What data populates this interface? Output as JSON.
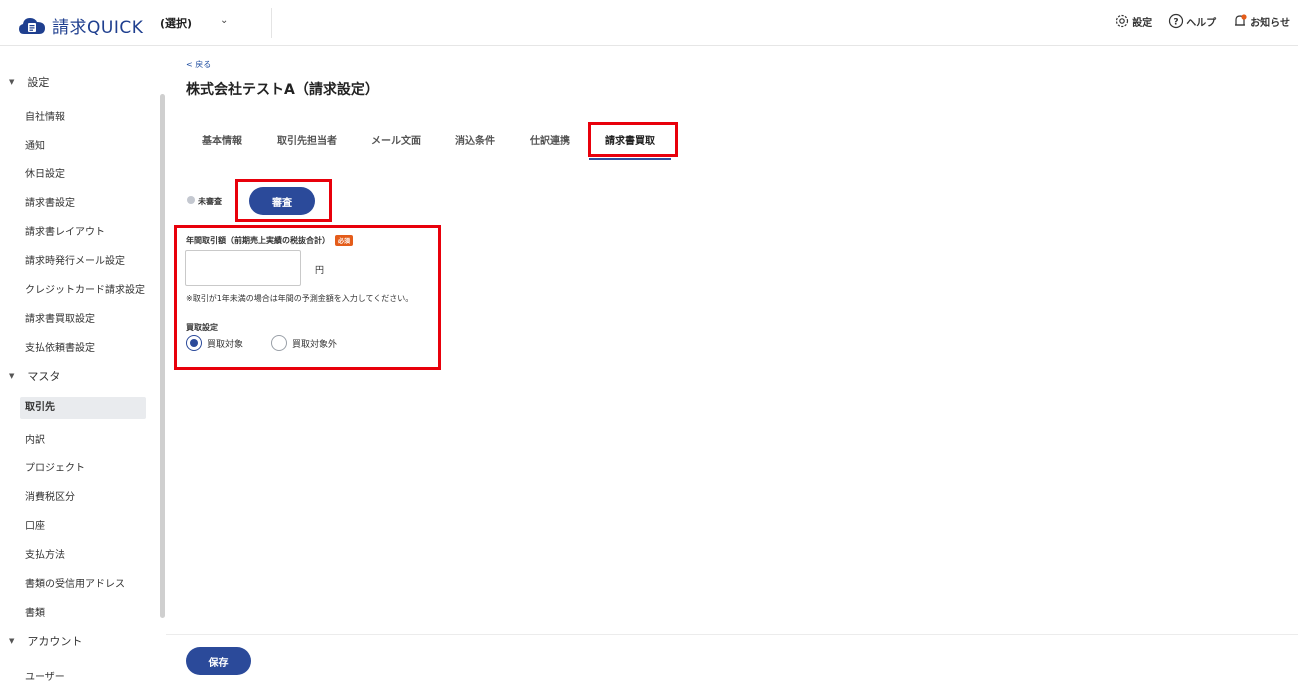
{
  "header": {
    "brand_cjk": "請求",
    "brand_latin": "QUICK",
    "company_select": "(選択)",
    "links": {
      "settings": "設定",
      "help": "ヘルプ",
      "notice": "お知らせ"
    }
  },
  "sidebar": {
    "section_settings": "設定",
    "settings_items": [
      "自社情報",
      "通知",
      "休日設定",
      "請求書設定",
      "請求書レイアウト",
      "請求時発行メール設定",
      "クレジットカード請求設定",
      "請求書買取設定",
      "支払依頼書設定"
    ],
    "section_master": "マスタ",
    "master_items": [
      "取引先",
      "内訳",
      "プロジェクト",
      "消費税区分",
      "口座",
      "支払方法",
      "書類の受信用アドレス",
      "書類"
    ],
    "section_account": "アカウント",
    "account_items": [
      "ユーザー"
    ],
    "active_item": "取引先"
  },
  "main": {
    "back": "< 戻る",
    "title": "株式会社テストA（請求設定）",
    "tabs": [
      "基本情報",
      "取引先担当者",
      "メール文面",
      "消込条件",
      "仕訳連携",
      "請求書買取"
    ],
    "active_tab": "請求書買取",
    "status_label": "未審査",
    "review_button": "審査",
    "annual_label": "年間取引額（前期売上実績の税抜合計）",
    "required_badge": "必須",
    "amount_value": "",
    "amount_placeholder": "",
    "unit": "円",
    "note": "※取引が1年未満の場合は年間の予測金額を入力してください。",
    "purchase_label": "買取設定",
    "radio_options": [
      "買取対象",
      "買取対象外"
    ],
    "selected_option": "買取対象"
  },
  "footer": {
    "save_button": "保存"
  },
  "colors": {
    "accent": "#2b4a9a",
    "highlight": "#e8000b",
    "required": "#e45c1a"
  }
}
